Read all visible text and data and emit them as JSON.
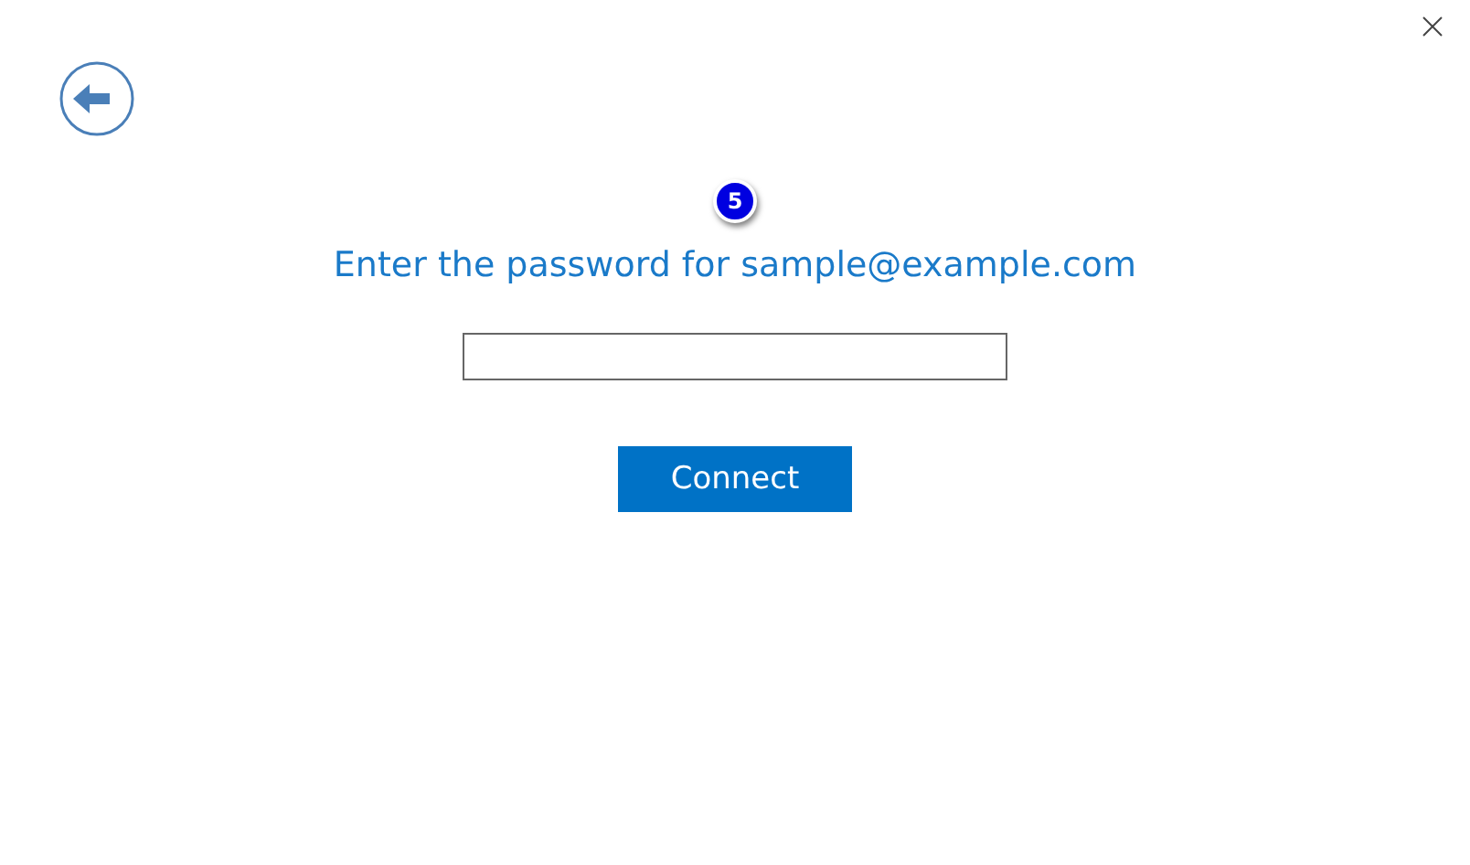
{
  "step_badge": "5",
  "title": "Enter the password for sample@example.com",
  "fields": [
    {
      "kind": "password"
    }
  ],
  "buttons": [
    {
      "label": "Connect",
      "kind": "primary"
    }
  ]
}
